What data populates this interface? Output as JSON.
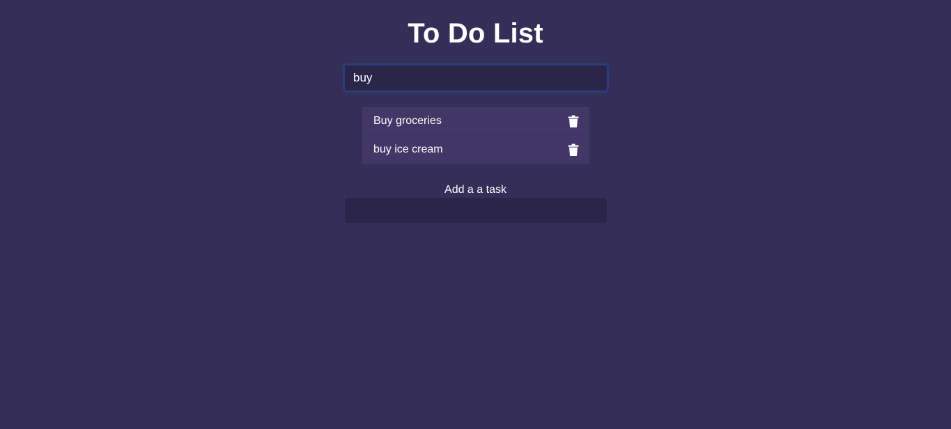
{
  "app": {
    "title": "To Do List"
  },
  "search": {
    "value": "buy",
    "placeholder": ""
  },
  "tasks": [
    {
      "label": "Buy groceries",
      "icon": "trash-icon"
    },
    {
      "label": "buy ice cream",
      "icon": "trash-icon"
    }
  ],
  "add_task": {
    "label": "Add a a task",
    "value": "",
    "placeholder": ""
  },
  "colors": {
    "background": "#352e59",
    "input_background": "#2b2549",
    "focus_border": "#2a3d7c",
    "task_background": "#423867",
    "text": "#ffffff"
  }
}
